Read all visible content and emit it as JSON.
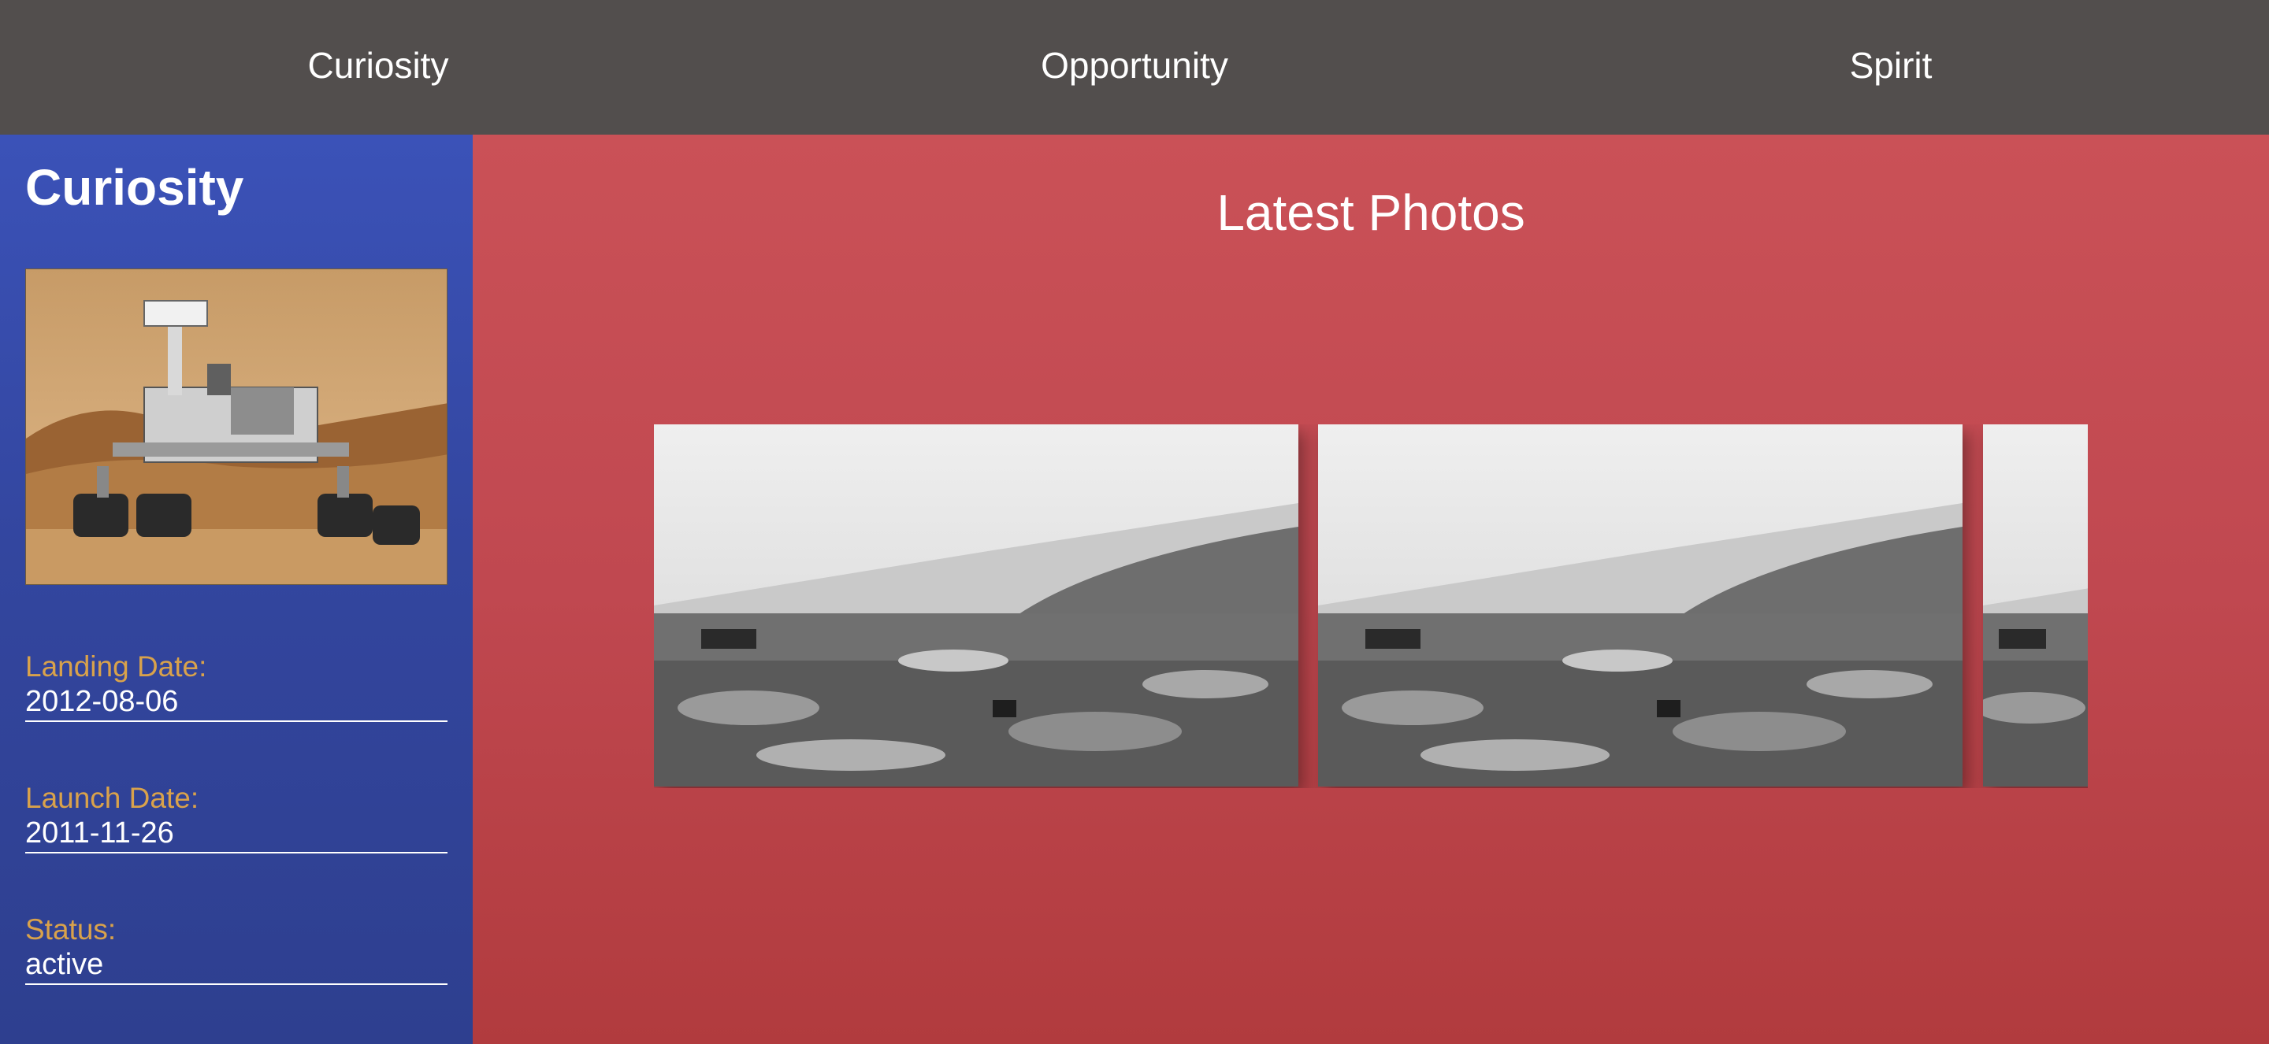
{
  "nav": {
    "items": [
      {
        "label": "Curiosity"
      },
      {
        "label": "Opportunity"
      },
      {
        "label": "Spirit"
      }
    ]
  },
  "sidebar": {
    "title": "Curiosity",
    "image_icon": "rover-image",
    "fields": {
      "landing": {
        "label": "Landing Date:",
        "value": "2012-08-06"
      },
      "launch": {
        "label": "Launch Date:",
        "value": "2011-11-26"
      },
      "status": {
        "label": "Status:",
        "value": "active"
      }
    }
  },
  "main": {
    "title": "Latest Photos",
    "photo_icon": "mars-landscape-image"
  },
  "colors": {
    "nav_bg": "#524e4d",
    "sidebar_bg": "#3a4fb2",
    "main_bg": "#c04850",
    "label_accent": "#d9a24b",
    "text": "#ffffff"
  }
}
